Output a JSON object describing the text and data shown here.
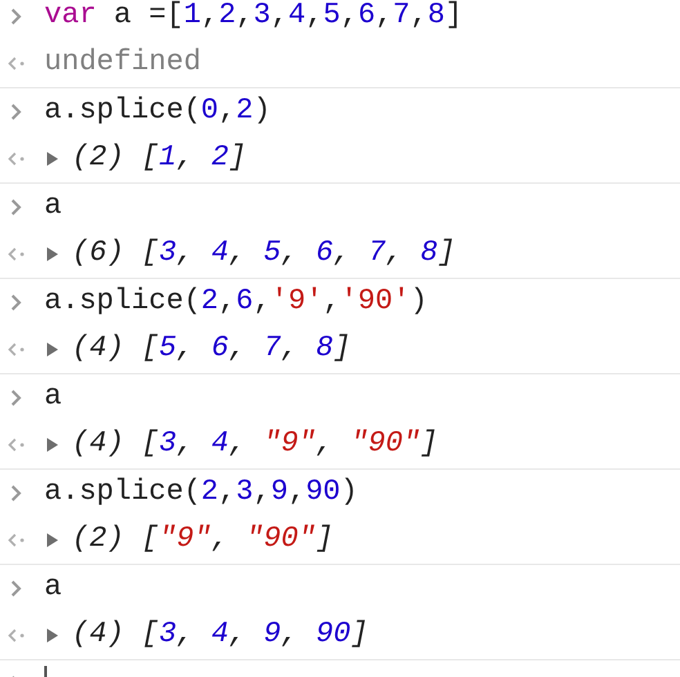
{
  "entries": [
    {
      "input": [
        {
          "t": "var",
          "kind": "keyword"
        },
        {
          "t": " a =",
          "kind": "plain"
        },
        {
          "t": "[",
          "kind": "plain"
        },
        {
          "t": "1",
          "kind": "number"
        },
        {
          "t": ",",
          "kind": "plain"
        },
        {
          "t": "2",
          "kind": "number"
        },
        {
          "t": ",",
          "kind": "plain"
        },
        {
          "t": "3",
          "kind": "number"
        },
        {
          "t": ",",
          "kind": "plain"
        },
        {
          "t": "4",
          "kind": "number"
        },
        {
          "t": ",",
          "kind": "plain"
        },
        {
          "t": "5",
          "kind": "number"
        },
        {
          "t": ",",
          "kind": "plain"
        },
        {
          "t": "6",
          "kind": "number"
        },
        {
          "t": ",",
          "kind": "plain"
        },
        {
          "t": "7",
          "kind": "number"
        },
        {
          "t": ",",
          "kind": "plain"
        },
        {
          "t": "8",
          "kind": "number"
        },
        {
          "t": "]",
          "kind": "plain"
        }
      ],
      "output": {
        "kind": "value",
        "tokens": [
          {
            "t": "undefined",
            "kind": "muted"
          }
        ]
      }
    },
    {
      "input": [
        {
          "t": "a.splice(",
          "kind": "plain"
        },
        {
          "t": "0",
          "kind": "number"
        },
        {
          "t": ",",
          "kind": "plain"
        },
        {
          "t": "2",
          "kind": "number"
        },
        {
          "t": ")",
          "kind": "plain"
        }
      ],
      "output": {
        "kind": "array",
        "expanded": false,
        "tokens": [
          {
            "t": "(2) [",
            "kind": "plain"
          },
          {
            "t": "1",
            "kind": "number"
          },
          {
            "t": ", ",
            "kind": "plain"
          },
          {
            "t": "2",
            "kind": "number"
          },
          {
            "t": "]",
            "kind": "plain"
          }
        ]
      }
    },
    {
      "input": [
        {
          "t": "a",
          "kind": "plain"
        }
      ],
      "output": {
        "kind": "array",
        "expanded": false,
        "tokens": [
          {
            "t": "(6) [",
            "kind": "plain"
          },
          {
            "t": "3",
            "kind": "number"
          },
          {
            "t": ", ",
            "kind": "plain"
          },
          {
            "t": "4",
            "kind": "number"
          },
          {
            "t": ", ",
            "kind": "plain"
          },
          {
            "t": "5",
            "kind": "number"
          },
          {
            "t": ", ",
            "kind": "plain"
          },
          {
            "t": "6",
            "kind": "number"
          },
          {
            "t": ", ",
            "kind": "plain"
          },
          {
            "t": "7",
            "kind": "number"
          },
          {
            "t": ", ",
            "kind": "plain"
          },
          {
            "t": "8",
            "kind": "number"
          },
          {
            "t": "]",
            "kind": "plain"
          }
        ]
      }
    },
    {
      "input": [
        {
          "t": "a.splice(",
          "kind": "plain"
        },
        {
          "t": "2",
          "kind": "number"
        },
        {
          "t": ",",
          "kind": "plain"
        },
        {
          "t": "6",
          "kind": "number"
        },
        {
          "t": ",",
          "kind": "plain"
        },
        {
          "t": "'9'",
          "kind": "string"
        },
        {
          "t": ",",
          "kind": "plain"
        },
        {
          "t": "'90'",
          "kind": "string"
        },
        {
          "t": ")",
          "kind": "plain"
        }
      ],
      "output": {
        "kind": "array",
        "expanded": false,
        "tokens": [
          {
            "t": "(4) [",
            "kind": "plain"
          },
          {
            "t": "5",
            "kind": "number"
          },
          {
            "t": ", ",
            "kind": "plain"
          },
          {
            "t": "6",
            "kind": "number"
          },
          {
            "t": ", ",
            "kind": "plain"
          },
          {
            "t": "7",
            "kind": "number"
          },
          {
            "t": ", ",
            "kind": "plain"
          },
          {
            "t": "8",
            "kind": "number"
          },
          {
            "t": "]",
            "kind": "plain"
          }
        ]
      }
    },
    {
      "input": [
        {
          "t": "a",
          "kind": "plain"
        }
      ],
      "output": {
        "kind": "array",
        "expanded": false,
        "tokens": [
          {
            "t": "(4) [",
            "kind": "plain"
          },
          {
            "t": "3",
            "kind": "number"
          },
          {
            "t": ", ",
            "kind": "plain"
          },
          {
            "t": "4",
            "kind": "number"
          },
          {
            "t": ", ",
            "kind": "plain"
          },
          {
            "t": "\"9\"",
            "kind": "string"
          },
          {
            "t": ", ",
            "kind": "plain"
          },
          {
            "t": "\"90\"",
            "kind": "string"
          },
          {
            "t": "]",
            "kind": "plain"
          }
        ]
      }
    },
    {
      "input": [
        {
          "t": "a.splice(",
          "kind": "plain"
        },
        {
          "t": "2",
          "kind": "number"
        },
        {
          "t": ",",
          "kind": "plain"
        },
        {
          "t": "3",
          "kind": "number"
        },
        {
          "t": ",",
          "kind": "plain"
        },
        {
          "t": "9",
          "kind": "number"
        },
        {
          "t": ",",
          "kind": "plain"
        },
        {
          "t": "90",
          "kind": "number"
        },
        {
          "t": ")",
          "kind": "plain"
        }
      ],
      "output": {
        "kind": "array",
        "expanded": false,
        "tokens": [
          {
            "t": "(2) [",
            "kind": "plain"
          },
          {
            "t": "\"9\"",
            "kind": "string"
          },
          {
            "t": ", ",
            "kind": "plain"
          },
          {
            "t": "\"90\"",
            "kind": "string"
          },
          {
            "t": "]",
            "kind": "plain"
          }
        ]
      }
    },
    {
      "input": [
        {
          "t": "a",
          "kind": "plain"
        }
      ],
      "output": {
        "kind": "array",
        "expanded": false,
        "tokens": [
          {
            "t": "(4) [",
            "kind": "plain"
          },
          {
            "t": "3",
            "kind": "number"
          },
          {
            "t": ", ",
            "kind": "plain"
          },
          {
            "t": "4",
            "kind": "number"
          },
          {
            "t": ", ",
            "kind": "plain"
          },
          {
            "t": "9",
            "kind": "number"
          },
          {
            "t": ", ",
            "kind": "plain"
          },
          {
            "t": "90",
            "kind": "number"
          },
          {
            "t": "]",
            "kind": "plain"
          }
        ]
      }
    }
  ],
  "prompt": {
    "focused": true
  }
}
